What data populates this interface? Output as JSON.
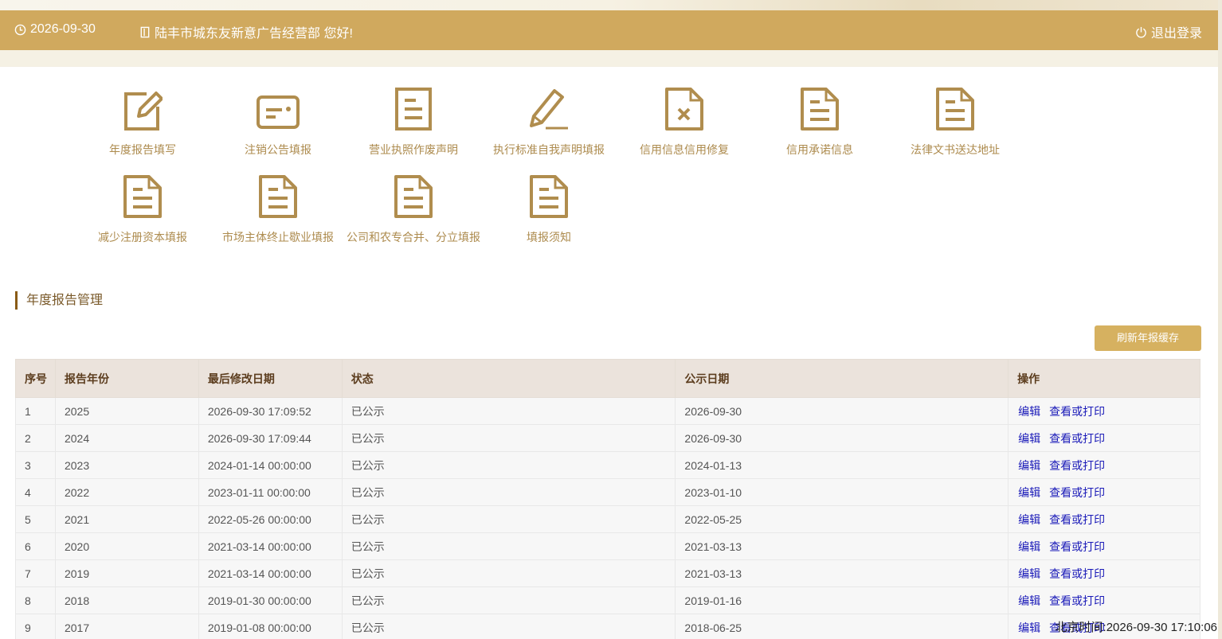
{
  "header": {
    "date": "2026-09-30",
    "greeting": "陆丰市城东友新意广告经营部 您好!",
    "logout_label": "退出登录"
  },
  "tiles": [
    {
      "label": "年度报告填写",
      "icon": "edit-icon"
    },
    {
      "label": "注销公告填报",
      "icon": "id-card-icon"
    },
    {
      "label": "营业执照作废声明",
      "icon": "document-icon"
    },
    {
      "label": "执行标准自我声明填报",
      "icon": "pencil-icon"
    },
    {
      "label": "信用信息信用修复",
      "icon": "document-x-icon"
    },
    {
      "label": "信用承诺信息",
      "icon": "document-icon"
    },
    {
      "label": "法律文书送达地址",
      "icon": "document-icon"
    },
    {
      "label": "减少注册资本填报",
      "icon": "document-icon"
    },
    {
      "label": "市场主体终止歇业填报",
      "icon": "document-icon"
    },
    {
      "label": "公司和农专合并、分立填报",
      "icon": "document-icon"
    },
    {
      "label": "填报须知",
      "icon": "document-icon"
    }
  ],
  "section": {
    "title": "年度报告管理",
    "refresh_label": "刷新年报缓存"
  },
  "table": {
    "columns": [
      "序号",
      "报告年份",
      "最后修改日期",
      "状态",
      "公示日期",
      "操作"
    ],
    "rows": [
      [
        "1",
        "2025",
        "2026-09-30 17:09:52",
        "已公示",
        "2026-09-30"
      ],
      [
        "2",
        "2024",
        "2026-09-30 17:09:44",
        "已公示",
        "2026-09-30"
      ],
      [
        "3",
        "2023",
        "2024-01-14 00:00:00",
        "已公示",
        "2024-01-13"
      ],
      [
        "4",
        "2022",
        "2023-01-11 00:00:00",
        "已公示",
        "2023-01-10"
      ],
      [
        "5",
        "2021",
        "2022-05-26 00:00:00",
        "已公示",
        "2022-05-25"
      ],
      [
        "6",
        "2020",
        "2021-03-14 00:00:00",
        "已公示",
        "2021-03-13"
      ],
      [
        "7",
        "2019",
        "2021-03-14 00:00:00",
        "已公示",
        "2021-03-13"
      ],
      [
        "8",
        "2018",
        "2019-01-30 00:00:00",
        "已公示",
        "2019-01-16"
      ],
      [
        "9",
        "2017",
        "2019-01-08 00:00:00",
        "已公示",
        "2018-06-25"
      ]
    ],
    "action_edit": "编辑",
    "action_view": "查看或打印"
  },
  "clock": "北京时间:2026-09-30 17:10:06",
  "colors": {
    "header_bg": "#d0a95e",
    "icon_gold": "#b08d4e",
    "link_blue": "#1a1ab8",
    "button_bg": "#d6b160"
  }
}
